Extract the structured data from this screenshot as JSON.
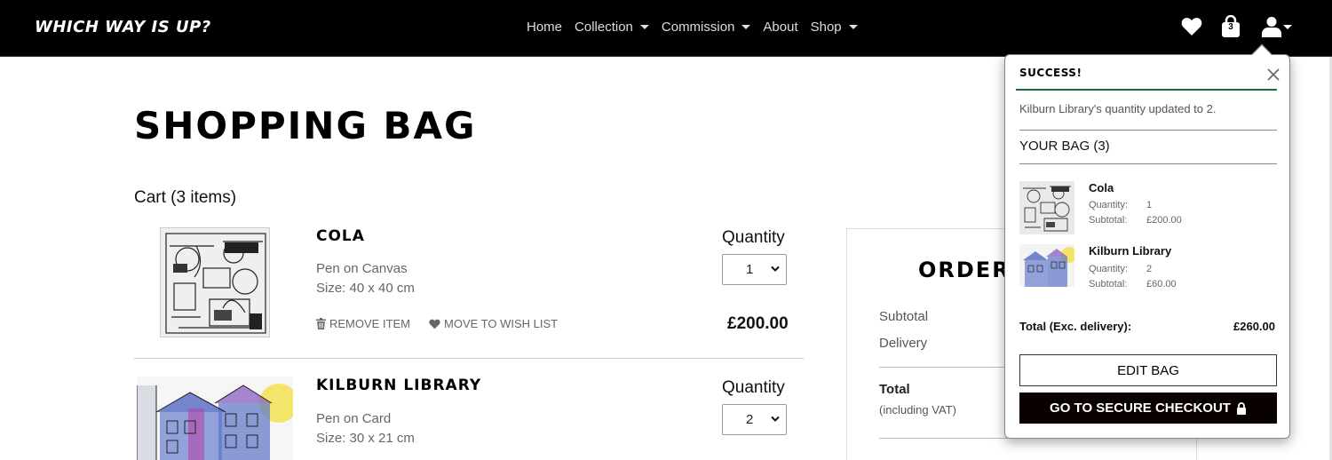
{
  "brand": "WHICH WAY IS UP?",
  "nav": {
    "links": [
      {
        "label": "Home",
        "dropdown": false
      },
      {
        "label": "Collection",
        "dropdown": true
      },
      {
        "label": "Commission",
        "dropdown": true
      },
      {
        "label": "About",
        "dropdown": false
      },
      {
        "label": "Shop",
        "dropdown": true
      }
    ],
    "bag_count": "3",
    "icons": [
      "heart-icon",
      "shopping-bag-icon",
      "user-icon"
    ]
  },
  "page": {
    "title": "SHOPPING BAG",
    "cart_heading": "Cart (3 items)"
  },
  "items": [
    {
      "name": "COLA",
      "medium": "Pen on Canvas",
      "size": "Size: 40 x 40 cm",
      "remove_label": "REMOVE ITEM",
      "wishlist_label": "MOVE TO WISH LIST",
      "quantity_label": "Quantity",
      "quantity": "1",
      "price": "£200.00"
    },
    {
      "name": "KILBURN LIBRARY",
      "medium": "Pen on Card",
      "size": "Size: 30 x 21 cm",
      "quantity_label": "Quantity",
      "quantity": "2"
    }
  ],
  "summary": {
    "title": "ORDER",
    "subtotal_label": "Subtotal",
    "delivery_label": "Delivery",
    "total_label": "Total",
    "vat_note": "(including VAT)"
  },
  "toast": {
    "heading": "SUCCESS!",
    "message": "Kilburn Library's quantity updated to 2.",
    "bag_heading": "YOUR BAG (3)",
    "items": [
      {
        "name": "Cola",
        "quantity_label": "Quantity:",
        "quantity": "1",
        "subtotal_label": "Subtotal:",
        "subtotal": "£200.00"
      },
      {
        "name": "Kilburn Library",
        "quantity_label": "Quantity:",
        "quantity": "2",
        "subtotal_label": "Subtotal:",
        "subtotal": "£60.00"
      }
    ],
    "total_label": "Total (Exc. delivery):",
    "total_value": "£260.00",
    "edit_button": "EDIT BAG",
    "checkout_button": "GO TO SECURE CHECKOUT"
  },
  "colors": {
    "navbar": "#000000",
    "success_rule": "#1a6b3a",
    "checkout_button": "#0a0000"
  }
}
